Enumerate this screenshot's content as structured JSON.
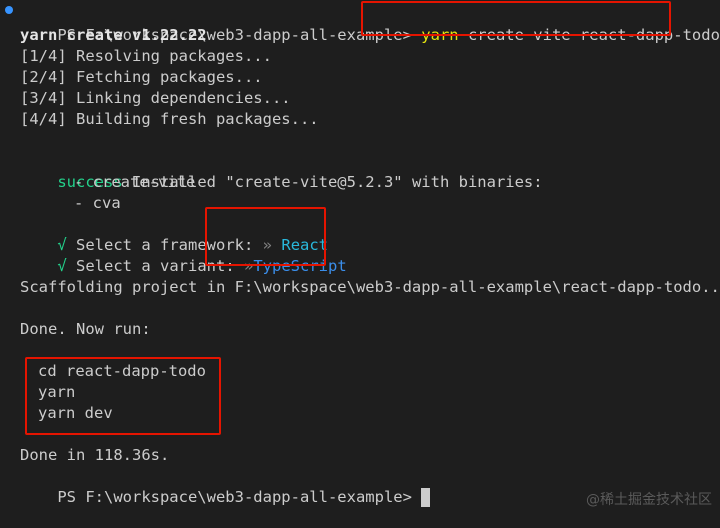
{
  "terminal": {
    "prompt_path": "PS F:\\workspace\\web3-dapp-all-example>",
    "command_keyword": "yarn",
    "command_rest": "create vite react-dapp-todo",
    "yarn_version": "yarn create v1.22.22",
    "steps": [
      "[1/4] Resolving packages...",
      "[2/4] Fetching packages...",
      "[3/4] Linking dependencies...",
      "[4/4] Building fresh packages..."
    ],
    "success_label": "success",
    "success_text": "Installed \"create-vite@5.2.3\" with binaries:",
    "binaries": [
      "- create-vite",
      "- cva"
    ],
    "framework_check": "√",
    "framework_label": "Select a framework:",
    "framework_arrow": "»",
    "framework_value": "React",
    "variant_check": "√",
    "variant_label": "Select a variant:",
    "variant_arrow": "»",
    "variant_value": "TypeScript",
    "scaffolding": "Scaffolding project in F:\\workspace\\web3-dapp-all-example\\react-dapp-todo...",
    "done_now_run": "Done. Now run:",
    "run_commands": [
      "cd react-dapp-todo",
      "yarn",
      "yarn dev"
    ],
    "done_time": "Done in 118.36s.",
    "final_prompt": "PS F:\\workspace\\web3-dapp-all-example>"
  },
  "watermark": "@稀土掘金技术社区",
  "colors": {
    "background": "#1e1e1e",
    "highlight_box": "#e51400",
    "success": "#23d18b",
    "framework": "#29b8db",
    "variant": "#3b8eea",
    "command": "#e5e510"
  }
}
